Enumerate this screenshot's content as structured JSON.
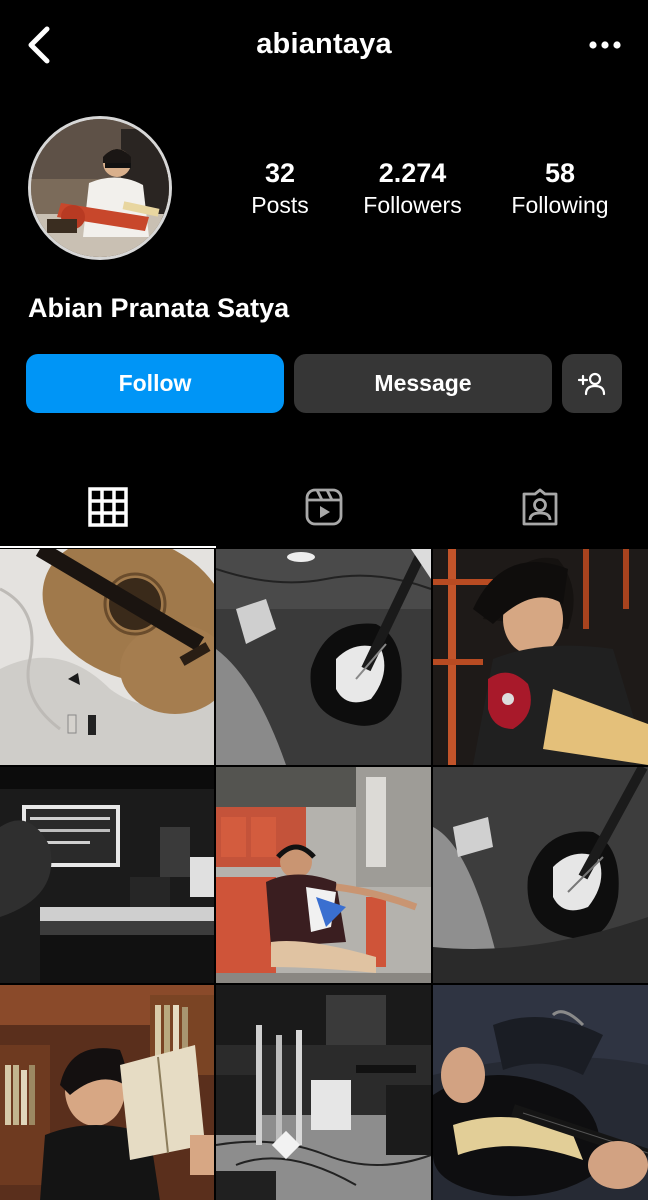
{
  "header": {
    "username": "abiantaya",
    "back_icon": "chevron-left-icon",
    "more_icon": "more-horizontal-icon"
  },
  "profile": {
    "full_name": "Abian Pranata Satya",
    "stats": [
      {
        "count": "32",
        "label": "Posts"
      },
      {
        "count": "2.274",
        "label": "Followers"
      },
      {
        "count": "58",
        "label": "Following"
      }
    ]
  },
  "actions": {
    "follow_label": "Follow",
    "message_label": "Message",
    "suggest_icon": "add-person-icon"
  },
  "tabs": [
    {
      "name": "posts-grid",
      "icon": "grid-icon",
      "active": true
    },
    {
      "name": "reels",
      "icon": "reels-icon",
      "active": false
    },
    {
      "name": "tagged",
      "icon": "tagged-person-icon",
      "active": false
    }
  ],
  "colors": {
    "background": "#000000",
    "follow_button": "#0095f6",
    "secondary_button": "#363636",
    "text": "#ffffff"
  }
}
